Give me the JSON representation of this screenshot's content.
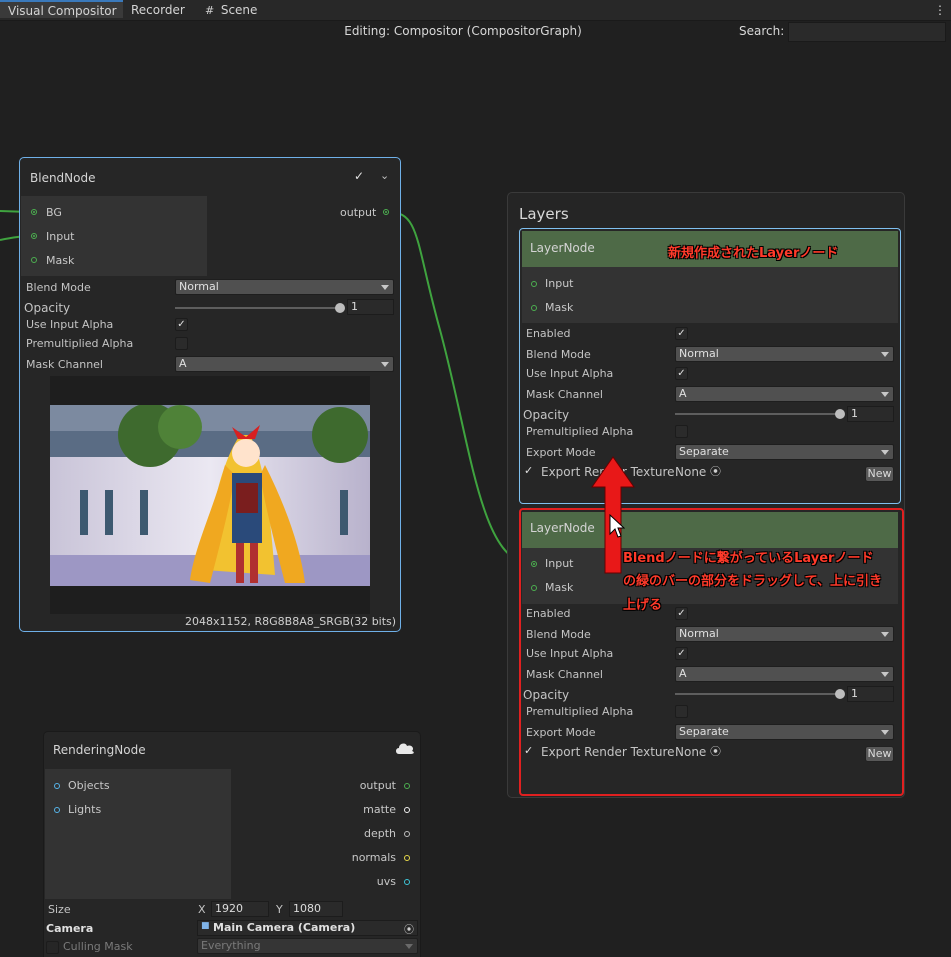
{
  "tabs": [
    {
      "label": "Visual Compositor",
      "active": true
    },
    {
      "label": "Recorder",
      "active": false
    },
    {
      "label": "Scene",
      "active": false
    }
  ],
  "header": {
    "title": "Editing: Compositor (CompositorGraph)",
    "search_label": "Search:"
  },
  "blend_node": {
    "title": "BlendNode",
    "inputs": [
      "BG",
      "Input",
      "Mask"
    ],
    "output": "output",
    "props": {
      "blend_mode_label": "Blend Mode",
      "blend_mode_value": "Normal",
      "opacity_label": "Opacity",
      "opacity_value": "1",
      "opacity_fraction": 1.0,
      "use_input_alpha_label": "Use Input Alpha",
      "use_input_alpha": true,
      "premultiplied_label": "Premultiplied Alpha",
      "premultiplied": false,
      "mask_channel_label": "Mask Channel",
      "mask_channel_value": "A"
    },
    "preview_info": "2048x1152, R8G8B8A8_SRGB(32 bits)"
  },
  "rendering_node": {
    "title": "RenderingNode",
    "inputs": [
      "Objects",
      "Lights"
    ],
    "outputs": [
      "output",
      "matte",
      "depth",
      "normals",
      "uvs"
    ],
    "size_label": "Size",
    "x_label": "X",
    "x_value": "1920",
    "y_label": "Y",
    "y_value": "1080",
    "camera_label": "Camera",
    "camera_value": "Main Camera (Camera)",
    "culling_label": "Culling Mask",
    "culling_value": "Everything"
  },
  "layers_panel": {
    "title": "Layers",
    "layer_nodes": [
      {
        "title": "LayerNode",
        "inputs": [
          "Input",
          "Mask"
        ],
        "enabled_label": "Enabled",
        "enabled": true,
        "blend_mode_label": "Blend Mode",
        "blend_mode_value": "Normal",
        "use_input_alpha_label": "Use Input Alpha",
        "use_input_alpha": true,
        "mask_channel_label": "Mask Channel",
        "mask_channel_value": "A",
        "opacity_label": "Opacity",
        "opacity_value": "1",
        "opacity_fraction": 1.0,
        "premultiplied_label": "Premultiplied Alpha",
        "premultiplied": false,
        "export_mode_label": "Export Mode",
        "export_mode_value": "Separate",
        "export_rt_label": "Export Render Texture",
        "export_rt_value": "None",
        "new_label": "New"
      },
      {
        "title": "LayerNode",
        "inputs": [
          "Input",
          "Mask"
        ],
        "enabled_label": "Enabled",
        "enabled": true,
        "blend_mode_label": "Blend Mode",
        "blend_mode_value": "Normal",
        "use_input_alpha_label": "Use Input Alpha",
        "use_input_alpha": true,
        "mask_channel_label": "Mask Channel",
        "mask_channel_value": "A",
        "opacity_label": "Opacity",
        "opacity_value": "1",
        "opacity_fraction": 1.0,
        "premultiplied_label": "Premultiplied Alpha",
        "premultiplied": false,
        "export_mode_label": "Export Mode",
        "export_mode_value": "Separate",
        "export_rt_label": "Export Render Texture",
        "export_rt_value": "None",
        "new_label": "New"
      }
    ]
  },
  "annotations": {
    "new_layer": "新規作成されたLayerノード",
    "drag_line1": "Blendノードに繋がっているLayerノード",
    "drag_line2": "の緑のバーの部分をドラッグして、上に引き",
    "drag_line3": "上げる"
  },
  "colors": {
    "accent_green": "#4caf50",
    "annotation_red": "#ff3a2a",
    "selection_blue": "#6fb0e8",
    "highlight_red": "#e02020"
  },
  "icons": [
    "check-icon",
    "chevron-down-icon",
    "grid-icon",
    "kebab-menu-icon",
    "cloud-icon",
    "camera-icon",
    "object-picker-icon",
    "up-arrow-icon",
    "mouse-cursor-icon"
  ]
}
